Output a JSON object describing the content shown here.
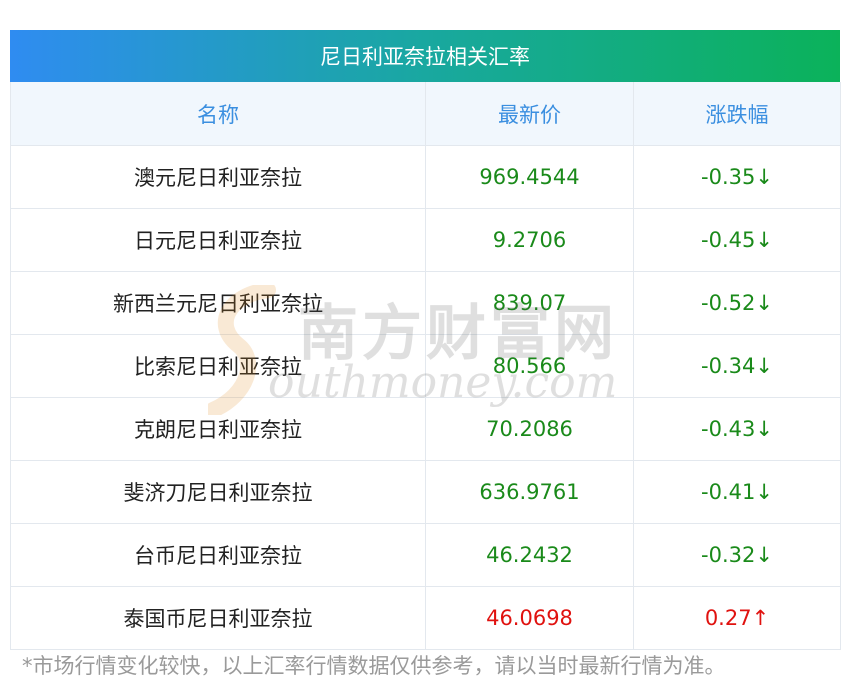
{
  "title": "尼日利亚奈拉相关汇率",
  "headers": {
    "name": "名称",
    "price": "最新价",
    "change": "涨跌幅"
  },
  "rows": [
    {
      "name": "澳元尼日利亚奈拉",
      "price": "969.4544",
      "change": "-0.35↓",
      "direction": "down"
    },
    {
      "name": "日元尼日利亚奈拉",
      "price": "9.2706",
      "change": "-0.45↓",
      "direction": "down"
    },
    {
      "name": "新西兰元尼日利亚奈拉",
      "price": "839.07",
      "change": "-0.52↓",
      "direction": "down"
    },
    {
      "name": "比索尼日利亚奈拉",
      "price": "80.566",
      "change": "-0.34↓",
      "direction": "down"
    },
    {
      "name": "克朗尼日利亚奈拉",
      "price": "70.2086",
      "change": "-0.43↓",
      "direction": "down"
    },
    {
      "name": "斐济刀尼日利亚奈拉",
      "price": "636.9761",
      "change": "-0.41↓",
      "direction": "down"
    },
    {
      "name": "台币尼日利亚奈拉",
      "price": "46.2432",
      "change": "-0.32↓",
      "direction": "down"
    },
    {
      "name": "泰国币尼日利亚奈拉",
      "price": "46.0698",
      "change": "0.27↑",
      "direction": "up"
    }
  ],
  "footnote": "*市场行情变化较快，以上汇率行情数据仅供参考，请以当时最新行情为准。",
  "watermark": {
    "cn": "南方财富网",
    "en": "outhmoney.com"
  },
  "colors": {
    "down": "#1a8a1a",
    "up": "#e0120f",
    "header_text": "#3b8fe0",
    "title_gradient_start": "#2f8cf1",
    "title_gradient_end": "#0bb25a"
  }
}
